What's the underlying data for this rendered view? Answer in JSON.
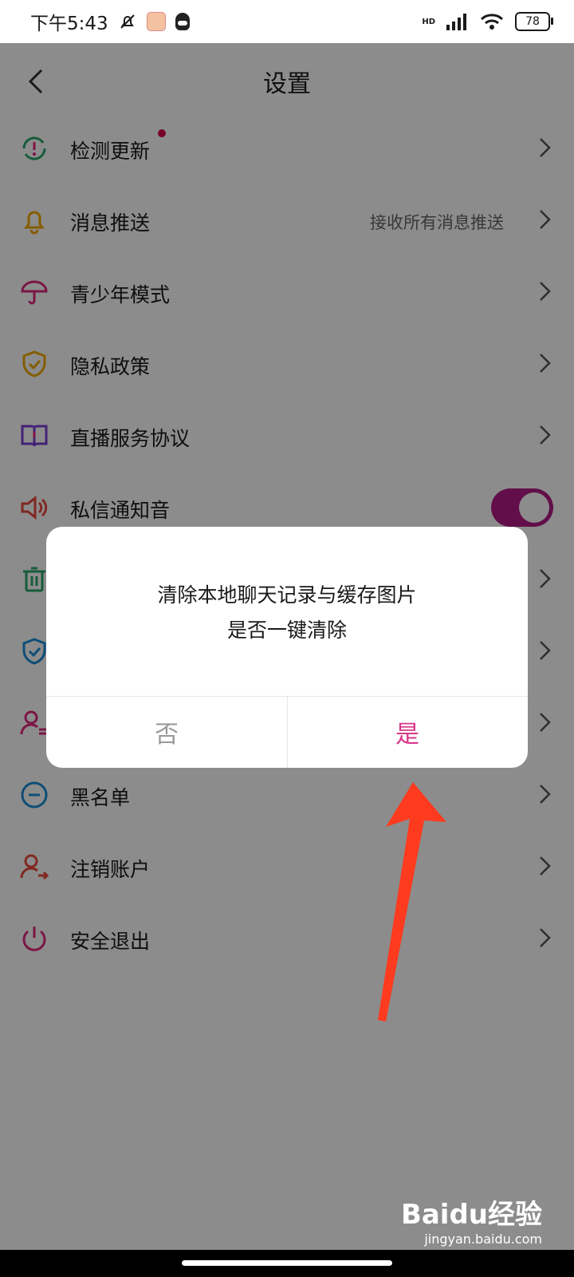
{
  "status": {
    "time": "下午5:43",
    "battery": "78",
    "hd": "HD"
  },
  "header": {
    "title": "设置"
  },
  "settings": [
    {
      "label": "检测更新",
      "icon": "update-icon",
      "color": "#2aa86b"
    },
    {
      "label": "消息推送",
      "value": "接收所有消息推送",
      "icon": "bell-icon",
      "color": "#f2a900"
    },
    {
      "label": "青少年模式",
      "icon": "umbrella-icon",
      "color": "#e0287f"
    },
    {
      "label": "隐私政策",
      "icon": "shield-check-icon",
      "color": "#f2a900"
    },
    {
      "label": "直播服务协议",
      "icon": "book-icon",
      "color": "#7b3fd6"
    },
    {
      "label": "私信通知音",
      "icon": "speaker-icon",
      "color": "#ea4b3c"
    },
    {
      "label": "",
      "icon": "trash-icon",
      "color": "#2aa86b"
    },
    {
      "label": "",
      "icon": "shield-icon",
      "color": "#1b8fd8"
    },
    {
      "label": "",
      "icon": "user-list-icon",
      "color": "#e0287f"
    },
    {
      "label": "黑名单",
      "icon": "minus-circle-icon",
      "color": "#1b8fd8"
    },
    {
      "label": "注销账户",
      "icon": "user-exit-icon",
      "color": "#ea4b3c"
    },
    {
      "label": "安全退出",
      "icon": "power-icon",
      "color": "#e0287f"
    }
  ],
  "dialog": {
    "line1": "清除本地聊天记录与缓存图片",
    "line2": "是否一键清除",
    "no_label": "否",
    "yes_label": "是"
  },
  "watermark": {
    "logo": "Baidu经验",
    "site": "jingyan.baidu.com"
  },
  "colors": {
    "accent": "#d9368c",
    "toggle": "#b21b87",
    "arrow": "#ff3b1f"
  }
}
